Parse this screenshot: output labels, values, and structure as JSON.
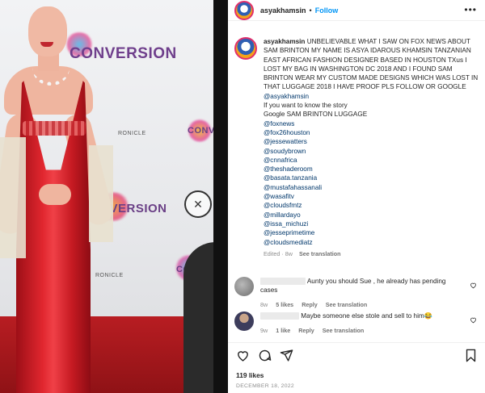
{
  "post": {
    "username": "asyakhamsin",
    "dot": "•",
    "follow_label": "Follow",
    "more_label": "•••"
  },
  "photo": {
    "logo_1": "CONVERSION",
    "logo_2": "ONVERSION",
    "logo_3": "CONV",
    "logo_4": "RONICLE",
    "logo_5": "CONV",
    "logo_6": "RONICLE"
  },
  "caption": {
    "username": "asyakhamsin",
    "line_1": "UNBELIEVABLE WHAT I SAW ON FOX NEWS ABOUT SAM BRINTON MY NAME IS ASYA IDAROUS KHAMSIN TANZANIAN EAST AFRICAN FASHION DESIGNER BASED IN HOUSTON TXus I LOST MY BAG IN WASHINGTON DC 2018 AND I FOUND SAM BRINTON WEAR MY CUSTOM MADE DESIGNS WHICH WAS LOST IN THAT LUGGAGE 2018 I HAVE PROOF PLS FOLLOW OR GOOGLE",
    "line_1_mention": "@asyakhamsin",
    "line_2": "If you want to know the story",
    "line_3": "Google SAM BRINTON LUGGAGE",
    "mentions": [
      "@foxnews",
      "@fox26houston",
      "@jessewatters",
      "@soudybrown",
      "@cnnafrica",
      "@theshaderoom",
      "@basata.tanzania",
      "@mustafahassanali",
      "@wasafitv",
      "@cloudsfmtz",
      "@millardayo",
      "@issa_michuzi",
      "@jesseprimetime",
      "@cloudsmediatz"
    ],
    "edited": "Edited · 8w",
    "see_translation": "See translation"
  },
  "comments": [
    {
      "text": "Aunty you should Sue , he already has pending cases",
      "age": "8w",
      "likes": "5 likes",
      "reply": "Reply",
      "see_translation": "See translation"
    },
    {
      "text": "Maybe someone else stole and sell to him😂",
      "age": "9w",
      "likes": "1 like",
      "reply": "Reply",
      "see_translation": "See translation"
    }
  ],
  "footer": {
    "likes": "119 likes",
    "date": "DECEMBER 18, 2022"
  },
  "icons": {
    "like": "heart-icon",
    "comment": "comment-icon",
    "share": "share-icon",
    "save": "bookmark-icon",
    "close": "close-icon"
  },
  "colors": {
    "link": "#00376b",
    "follow": "#0095f6",
    "muted": "#8e8e8e",
    "dress": "#d9232b"
  }
}
